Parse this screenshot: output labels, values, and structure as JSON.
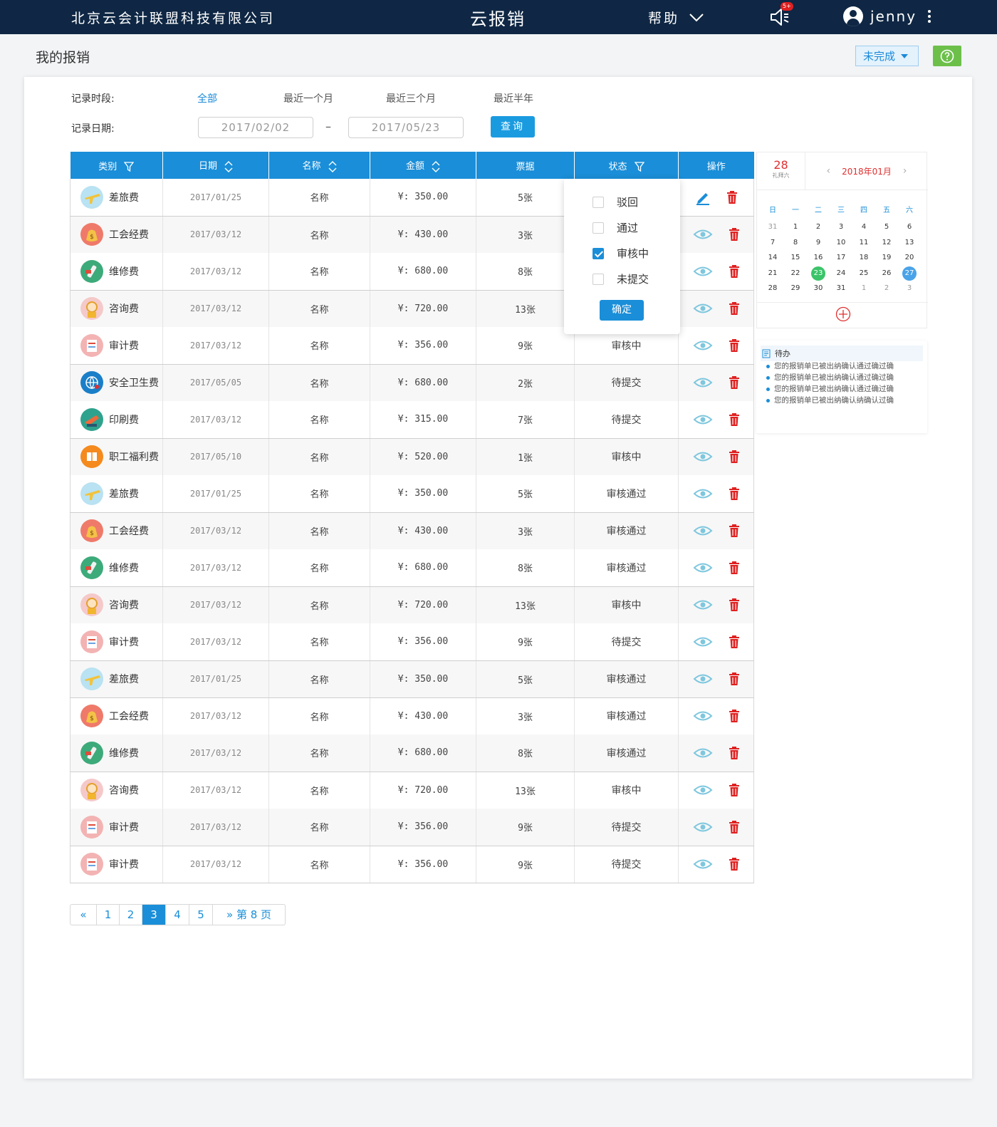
{
  "header": {
    "company": "北京云会计联盟科技有限公司",
    "app_title": "云报销",
    "help_label": "帮助",
    "notif_badge": "5+",
    "username": "jenny"
  },
  "page": {
    "title": "我的报销",
    "status_filter": "未完成"
  },
  "filters": {
    "period_label": "记录时段:",
    "periods": [
      "全部",
      "最近一个月",
      "最近三个月",
      "最近半年"
    ],
    "date_label": "记录日期:",
    "date_from": "2017/02/02",
    "date_to": "2017/05/23",
    "date_sep": "–",
    "query_label": "查询"
  },
  "table": {
    "headers": [
      "类别",
      "日期",
      "名称",
      "金额",
      "票据",
      "状态",
      "操作"
    ],
    "rows": [
      {
        "cat": "差旅费",
        "icon": "plane-icon",
        "date": "2017/01/25",
        "name": "名称",
        "amount": "¥: 350.00",
        "tickets": "5张",
        "status": ""
      },
      {
        "cat": "工会经费",
        "icon": "money-bag-icon",
        "date": "2017/03/12",
        "name": "名称",
        "amount": "¥: 430.00",
        "tickets": "3张",
        "status": ""
      },
      {
        "cat": "维修费",
        "icon": "wrench-icon",
        "date": "2017/03/12",
        "name": "名称",
        "amount": "¥: 680.00",
        "tickets": "8张",
        "status": ""
      },
      {
        "cat": "咨询费",
        "icon": "consultant-icon",
        "date": "2017/03/12",
        "name": "名称",
        "amount": "¥: 720.00",
        "tickets": "13张",
        "status": ""
      },
      {
        "cat": "审计费",
        "icon": "audit-icon",
        "date": "2017/03/12",
        "name": "名称",
        "amount": "¥: 356.00",
        "tickets": "9张",
        "status": "审核中"
      },
      {
        "cat": "安全卫生费",
        "icon": "globe-icon",
        "date": "2017/05/05",
        "name": "名称",
        "amount": "¥: 680.00",
        "tickets": "2张",
        "status": "待提交"
      },
      {
        "cat": "印刷费",
        "icon": "printer-icon",
        "date": "2017/03/12",
        "name": "名称",
        "amount": "¥: 315.00",
        "tickets": "7张",
        "status": "待提交"
      },
      {
        "cat": "职工福利费",
        "icon": "book-icon",
        "date": "2017/05/10",
        "name": "名称",
        "amount": "¥: 520.00",
        "tickets": "1张",
        "status": "审核中"
      },
      {
        "cat": "差旅费",
        "icon": "plane-icon",
        "date": "2017/01/25",
        "name": "名称",
        "amount": "¥: 350.00",
        "tickets": "5张",
        "status": "审核通过"
      },
      {
        "cat": "工会经费",
        "icon": "money-bag-icon",
        "date": "2017/03/12",
        "name": "名称",
        "amount": "¥: 430.00",
        "tickets": "3张",
        "status": "审核通过"
      },
      {
        "cat": "维修费",
        "icon": "wrench-icon",
        "date": "2017/03/12",
        "name": "名称",
        "amount": "¥: 680.00",
        "tickets": "8张",
        "status": "审核通过"
      },
      {
        "cat": "咨询费",
        "icon": "consultant-icon",
        "date": "2017/03/12",
        "name": "名称",
        "amount": "¥: 720.00",
        "tickets": "13张",
        "status": "审核中"
      },
      {
        "cat": "审计费",
        "icon": "audit-icon",
        "date": "2017/03/12",
        "name": "名称",
        "amount": "¥: 356.00",
        "tickets": "9张",
        "status": "待提交"
      },
      {
        "cat": "差旅费",
        "icon": "plane-icon",
        "date": "2017/01/25",
        "name": "名称",
        "amount": "¥: 350.00",
        "tickets": "5张",
        "status": "审核通过"
      },
      {
        "cat": "工会经费",
        "icon": "money-bag-icon",
        "date": "2017/03/12",
        "name": "名称",
        "amount": "¥: 430.00",
        "tickets": "3张",
        "status": "审核通过"
      },
      {
        "cat": "维修费",
        "icon": "wrench-icon",
        "date": "2017/03/12",
        "name": "名称",
        "amount": "¥: 680.00",
        "tickets": "8张",
        "status": "审核通过"
      },
      {
        "cat": "咨询费",
        "icon": "consultant-icon",
        "date": "2017/03/12",
        "name": "名称",
        "amount": "¥: 720.00",
        "tickets": "13张",
        "status": "审核中"
      },
      {
        "cat": "审计费",
        "icon": "audit-icon",
        "date": "2017/03/12",
        "name": "名称",
        "amount": "¥: 356.00",
        "tickets": "9张",
        "status": "待提交"
      },
      {
        "cat": "审计费",
        "icon": "audit-icon",
        "date": "2017/03/12",
        "name": "名称",
        "amount": "¥: 356.00",
        "tickets": "9张",
        "status": "待提交"
      }
    ]
  },
  "status_filter_dropdown": {
    "options": [
      {
        "label": "驳回",
        "checked": false
      },
      {
        "label": "通过",
        "checked": false
      },
      {
        "label": "审核中",
        "checked": true
      },
      {
        "label": "未提交",
        "checked": false
      }
    ],
    "confirm_label": "确定"
  },
  "calendar": {
    "today_day": "28",
    "today_weekday": "礼拜六",
    "month_label": "2018年01月",
    "weekdays": [
      "日",
      "一",
      "二",
      "三",
      "四",
      "五",
      "六"
    ],
    "weeks": [
      [
        "31",
        "1",
        "2",
        "3",
        "4",
        "5",
        "6"
      ],
      [
        "7",
        "8",
        "9",
        "10",
        "11",
        "12",
        "13"
      ],
      [
        "14",
        "15",
        "16",
        "17",
        "18",
        "19",
        "20"
      ],
      [
        "21",
        "22",
        "23",
        "24",
        "25",
        "26",
        "27"
      ],
      [
        "28",
        "29",
        "30",
        "31",
        "1",
        "2",
        "3"
      ]
    ],
    "highlight_green": "23",
    "highlight_blue": "27"
  },
  "todo": {
    "title": "待办",
    "items": [
      "您的报销单已被出纳确认通过确过确",
      "您的报销单已被出纳确认通过确过确",
      "您的报销单已被出纳确认通过确过确",
      "您的报销单已被出纳确认纳确认过确"
    ]
  },
  "pagination": {
    "pages": [
      "1",
      "2",
      "3",
      "4",
      "5"
    ],
    "current": "3",
    "jump_label": "第 8 页"
  },
  "colors": {
    "primary": "#1a8ed8",
    "header_bg": "#0f2744",
    "status_review": "#e03030",
    "status_approved": "#33b033",
    "status_pending": "#3a8fdd",
    "help_green": "#6cc04a"
  }
}
